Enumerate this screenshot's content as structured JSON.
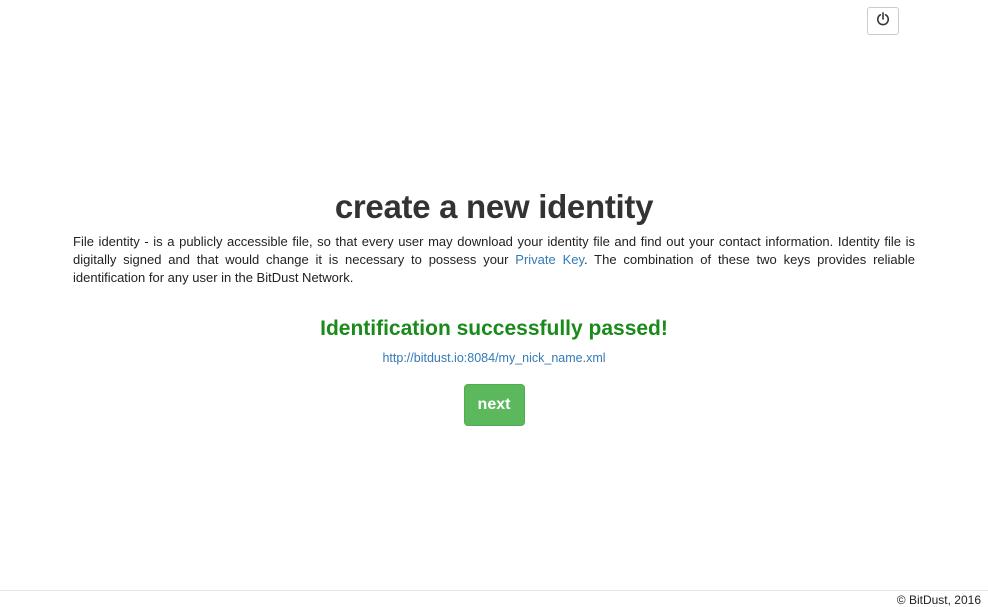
{
  "header": {
    "power_icon": "power-icon"
  },
  "main": {
    "title": "create a new identity",
    "description_part1": "File identity - is a publicly accessible file, so that every user may download your identity file and find out your contact information. Identity file is digitally signed and that would change it is necessary to possess your ",
    "private_key_link": "Private Key",
    "description_part2": ". The combination of these two keys provides reliable identification for any user in the BitDust Network.",
    "success_message": "Identification successfully passed!",
    "identity_url": "http://bitdust.io:8084/my_nick_name.xml",
    "next_label": "next"
  },
  "footer": {
    "copyright": "© BitDust, 2016"
  },
  "colors": {
    "success": "#1a8a1a",
    "link": "#337ab7",
    "button_green": "#5cb85c"
  }
}
